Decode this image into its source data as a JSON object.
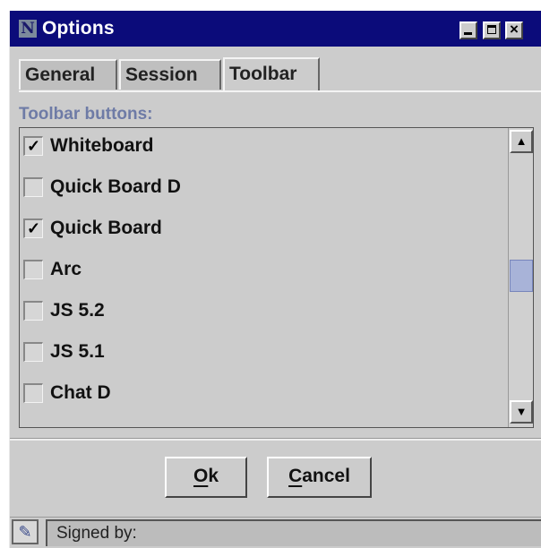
{
  "window": {
    "title": "Options",
    "app_icon": "N"
  },
  "titlebar_buttons": {
    "minimize_icon": "minimize-icon",
    "maximize_icon": "maximize-icon",
    "close_icon": "close-icon"
  },
  "tabs": [
    {
      "label": "General",
      "active": false
    },
    {
      "label": "Session",
      "active": false
    },
    {
      "label": "Toolbar",
      "active": true
    }
  ],
  "toolbar_section": {
    "label": "Toolbar buttons:",
    "items": [
      {
        "label": "Whiteboard",
        "checked": true
      },
      {
        "label": "Quick Board D",
        "checked": false
      },
      {
        "label": "Quick Board",
        "checked": true
      },
      {
        "label": "Arc",
        "checked": false
      },
      {
        "label": "JS 5.2",
        "checked": false
      },
      {
        "label": "JS 5.1",
        "checked": false
      },
      {
        "label": "Chat D",
        "checked": false
      }
    ],
    "scroll_position": 0.5
  },
  "buttons": {
    "ok_mnemonic": "O",
    "ok_rest": "k",
    "cancel_mnemonic": "C",
    "cancel_rest": "ancel"
  },
  "status": {
    "text": "Signed by:",
    "icon": "certificate-icon"
  },
  "colors": {
    "titlebar": "#0b0b7a",
    "section_label": "#6e7ba6",
    "scroll_thumb": "#a8b3d8",
    "window_bg": "#cccccc"
  }
}
